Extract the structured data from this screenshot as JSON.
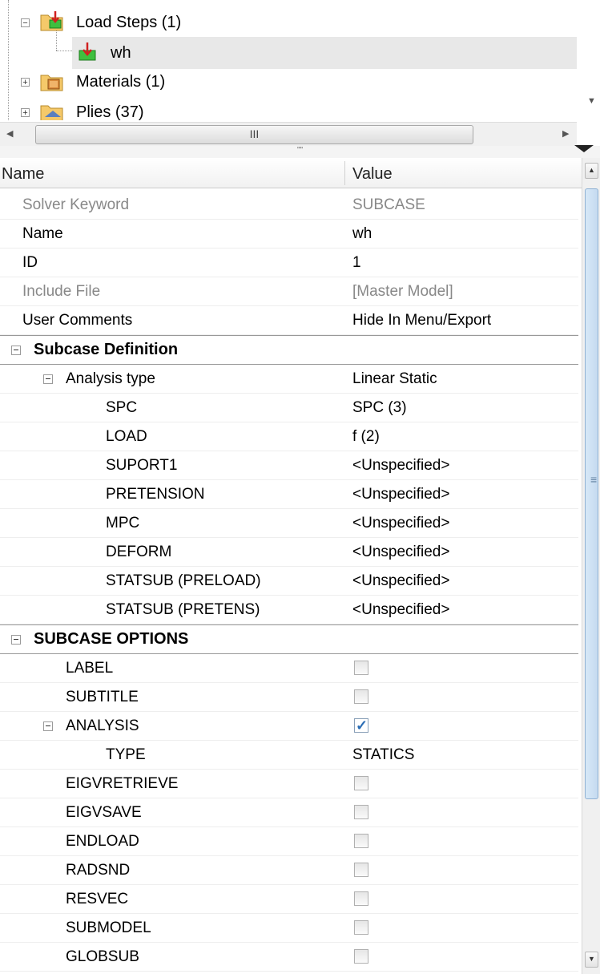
{
  "tree": {
    "items": [
      {
        "label": "Load Steps (1)",
        "icon": "load-steps-folder-icon"
      },
      {
        "label": "wh",
        "icon": "load-step-icon"
      },
      {
        "label": "Materials (1)",
        "icon": "materials-folder-icon"
      },
      {
        "label": "Plies (37)",
        "icon": "plies-folder-icon"
      }
    ],
    "hscroll_grip": "III",
    "splitter_grip": "\"\""
  },
  "grid": {
    "header": {
      "name": "Name",
      "value": "Value"
    },
    "rows": [
      {
        "name": "Solver Keyword",
        "value": "SUBCASE"
      },
      {
        "name": "Name",
        "value": "wh"
      },
      {
        "name": "ID",
        "value": "1"
      },
      {
        "name": "Include File",
        "value": "[Master Model]"
      },
      {
        "name": "User Comments",
        "value": "Hide In Menu/Export"
      },
      {
        "name": "Subcase Definition",
        "value": ""
      },
      {
        "name": "Analysis type",
        "value": "Linear Static"
      },
      {
        "name": "SPC",
        "value": "SPC (3)"
      },
      {
        "name": "LOAD",
        "value": "f (2)"
      },
      {
        "name": "SUPORT1",
        "value": "<Unspecified>"
      },
      {
        "name": "PRETENSION",
        "value": "<Unspecified>"
      },
      {
        "name": "MPC",
        "value": "<Unspecified>"
      },
      {
        "name": "DEFORM",
        "value": "<Unspecified>"
      },
      {
        "name": "STATSUB (PRELOAD)",
        "value": "<Unspecified>"
      },
      {
        "name": "STATSUB (PRETENS)",
        "value": "<Unspecified>"
      },
      {
        "name": "SUBCASE OPTIONS",
        "value": ""
      },
      {
        "name": "LABEL",
        "checked": false
      },
      {
        "name": "SUBTITLE",
        "checked": false
      },
      {
        "name": "ANALYSIS",
        "checked": true
      },
      {
        "name": "TYPE",
        "value": "STATICS"
      },
      {
        "name": "EIGVRETRIEVE",
        "checked": false
      },
      {
        "name": "EIGVSAVE",
        "checked": false
      },
      {
        "name": "ENDLOAD",
        "checked": false
      },
      {
        "name": "RADSND",
        "checked": false
      },
      {
        "name": "RESVEC",
        "checked": false
      },
      {
        "name": "SUBMODEL",
        "checked": false
      },
      {
        "name": "GLOBSUB",
        "checked": false
      }
    ]
  },
  "colors": {
    "selected_row": "#e8e8e8",
    "scroll_thumb": "#c5daf0",
    "checkmark": "#2a6db5"
  }
}
